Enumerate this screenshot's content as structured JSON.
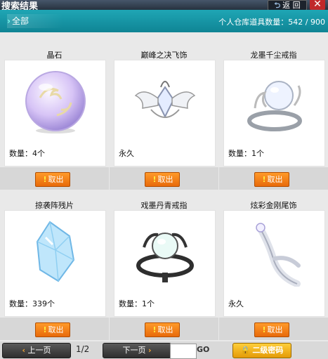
{
  "window": {
    "title": "搜索结果",
    "back_label": "返 回",
    "close_glyph": "✕"
  },
  "category": {
    "tab_label": "全部",
    "capacity_text": "个人仓库道具数量：542 / 900"
  },
  "items": [
    {
      "name": "晶石",
      "quantity": "数量：4个",
      "action": "取出"
    },
    {
      "name": "巅峰之决飞饰",
      "quantity": "永久",
      "action": "取出"
    },
    {
      "name": "龙墨千尘戒指",
      "quantity": "数量：1个",
      "action": "取出"
    },
    {
      "name": "掠袭阵残片",
      "quantity": "数量：339个",
      "action": "取出"
    },
    {
      "name": "戏墨丹青戒指",
      "quantity": "数量：1个",
      "action": "取出"
    },
    {
      "name": "炫彩金刚尾饰",
      "quantity": "永久",
      "action": "取出"
    }
  ],
  "pager": {
    "prev_label": "上一页",
    "page_text": "1/2",
    "next_label": "下一页",
    "go_label": "GO",
    "input_value": "",
    "password_label": "二级密码"
  }
}
